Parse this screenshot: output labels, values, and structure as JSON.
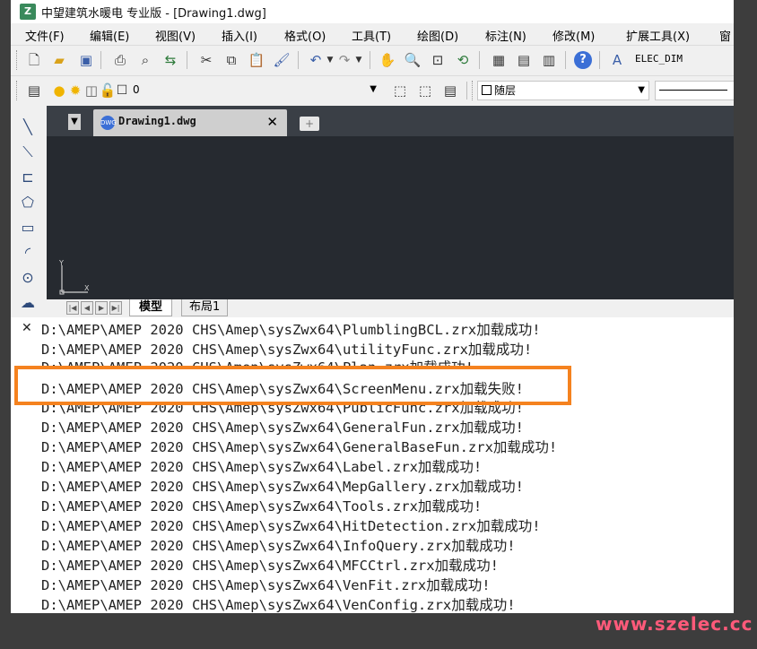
{
  "window": {
    "title": "中望建筑水暖电 专业版 - [Drawing1.dwg]",
    "logo": "Z"
  },
  "menu": {
    "items": [
      "文件(F)",
      "编辑(E)",
      "视图(V)",
      "插入(I)",
      "格式(O)",
      "工具(T)",
      "绘图(D)",
      "标注(N)",
      "修改(M)",
      "扩展工具(X)",
      "窗"
    ]
  },
  "toolbar1": {
    "dim_style_value": "ELEC_DIM"
  },
  "toolbar2": {
    "layer_value": "0",
    "color_value": "随层"
  },
  "document": {
    "tab_label": "Drawing1.dwg",
    "tab_icon_text": "DWG",
    "close_glyph": "✕",
    "new_tab_glyph": "+"
  },
  "ucs": {
    "x_label": "X",
    "y_label": "Y"
  },
  "layout_tabs": {
    "model": "模型",
    "layout1": "布局1"
  },
  "command_panel": {
    "close_glyph": "✕",
    "lines": [
      "D:\\AMEP\\AMEP 2020 CHS\\Amep\\sysZwx64\\PlumblingBCL.zrx加载成功!",
      "D:\\AMEP\\AMEP 2020 CHS\\Amep\\sysZwx64\\utilityFunc.zrx加载成功!",
      "D:\\AMEP\\AMEP 2020 CHS\\Amep\\sysZwx64\\Plan.zrx加载成功!",
      "D:\\AMEP\\AMEP 2020 CHS\\Amep\\sysZwx64\\ScreenMenu.zrx加载失败!",
      "D:\\AMEP\\AMEP 2020 CHS\\Amep\\sysZwx64\\PublicFunc.zrx加载成功!",
      "D:\\AMEP\\AMEP 2020 CHS\\Amep\\sysZwx64\\GeneralFun.zrx加载成功!",
      "D:\\AMEP\\AMEP 2020 CHS\\Amep\\sysZwx64\\GeneralBaseFun.zrx加载成功!",
      "D:\\AMEP\\AMEP 2020 CHS\\Amep\\sysZwx64\\Label.zrx加载成功!",
      "D:\\AMEP\\AMEP 2020 CHS\\Amep\\sysZwx64\\MepGallery.zrx加载成功!",
      "D:\\AMEP\\AMEP 2020 CHS\\Amep\\sysZwx64\\Tools.zrx加载成功!",
      "D:\\AMEP\\AMEP 2020 CHS\\Amep\\sysZwx64\\HitDetection.zrx加载成功!",
      "D:\\AMEP\\AMEP 2020 CHS\\Amep\\sysZwx64\\InfoQuery.zrx加载成功!",
      "D:\\AMEP\\AMEP 2020 CHS\\Amep\\sysZwx64\\MFCCtrl.zrx加载成功!",
      "D:\\AMEP\\AMEP 2020 CHS\\Amep\\sysZwx64\\VenFit.zrx加载成功!",
      "D:\\AMEP\\AMEP 2020 CHS\\Amep\\sysZwx64\\VenConfig.zrx加载成功!"
    ]
  },
  "watermark": "www.szelec.cc",
  "colors": {
    "highlight": "#f5821f",
    "canvas": "#262a30",
    "watermark": "#ff5a7a"
  }
}
